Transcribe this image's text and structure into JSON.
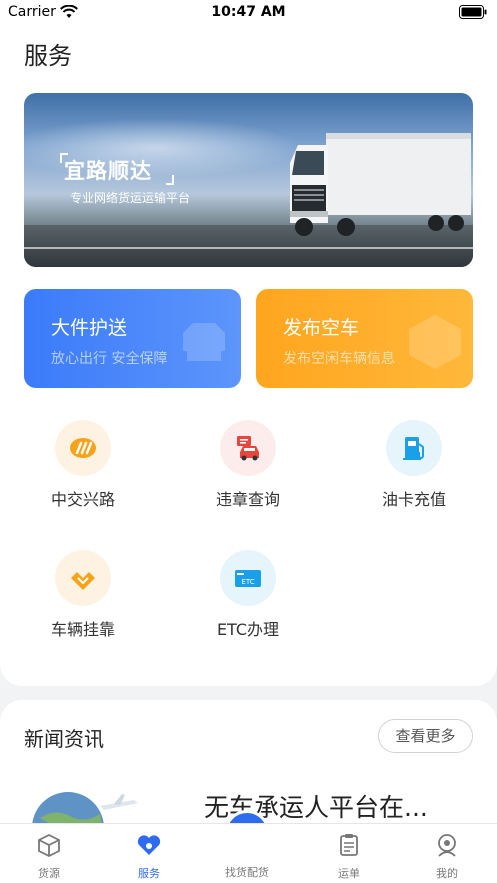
{
  "status_bar": {
    "carrier": "Carrier",
    "time": "10:47 AM"
  },
  "page": {
    "title": "服务"
  },
  "banner": {
    "title": "宜路顺达",
    "subtitle": "专业网络货运运输平台"
  },
  "feature_cards": [
    {
      "title": "大件护送",
      "subtitle": "放心出行  安全保障",
      "color": "#3b7bfa"
    },
    {
      "title": "发布空车",
      "subtitle": "发布空闲车辆信息",
      "color": "#ffa51e"
    }
  ],
  "services": [
    {
      "label": "中交兴路",
      "icon": "zhongjiao-logo-icon",
      "color": "#f7a21b"
    },
    {
      "label": "违章查询",
      "icon": "violation-car-icon",
      "color": "#e8453c"
    },
    {
      "label": "油卡充值",
      "icon": "fuel-pump-icon",
      "color": "#1aa0e8"
    },
    {
      "label": "车辆挂靠",
      "icon": "heart-hands-icon",
      "color": "#f7a21b"
    },
    {
      "label": "ETC办理",
      "icon": "etc-card-icon",
      "color": "#1aa0e8"
    }
  ],
  "news": {
    "title": "新闻资讯",
    "more_label": "查看更多",
    "items": [
      {
        "headline": "无车承运人平台在..."
      }
    ]
  },
  "tab_bar": {
    "tabs": [
      {
        "label": "货源",
        "icon": "cube-icon"
      },
      {
        "label": "服务",
        "icon": "heart-service-icon",
        "active": true
      },
      {
        "label": "找货配货",
        "icon": "search-doc-icon"
      },
      {
        "label": "运单",
        "icon": "clipboard-icon"
      },
      {
        "label": "我的",
        "icon": "profile-icon"
      }
    ],
    "active_color": "#2f6bf0"
  }
}
